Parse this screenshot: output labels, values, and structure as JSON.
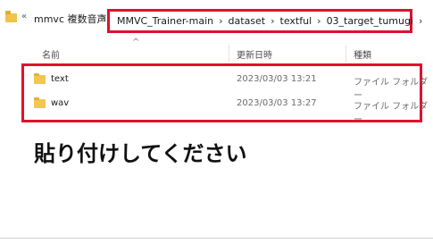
{
  "address": {
    "overflow": "«",
    "first_crumb": "mmvc 複数音声",
    "separator": "›",
    "crumbs": [
      "MMVC_Trainer-main",
      "dataset",
      "textful",
      "03_target_tumugi"
    ]
  },
  "columns": {
    "name": "名前",
    "date": "更新日時",
    "type": "種類",
    "sort_caret": "^"
  },
  "files": [
    {
      "name": "text",
      "date": "2023/03/03 13:21",
      "type": "ファイル フォルダー"
    },
    {
      "name": "wav",
      "date": "2023/03/03 13:27",
      "type": "ファイル フォルダー"
    }
  ],
  "annotation": {
    "paste_here": "貼り付けしてください"
  },
  "colors": {
    "highlight": "#e0102e",
    "folder": "#f3c74f"
  }
}
